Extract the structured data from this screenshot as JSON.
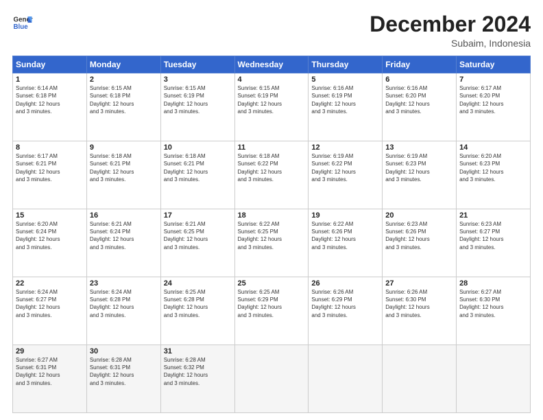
{
  "header": {
    "logo_line1": "General",
    "logo_line2": "Blue",
    "month": "December 2024",
    "location": "Subaim, Indonesia"
  },
  "days_of_week": [
    "Sunday",
    "Monday",
    "Tuesday",
    "Wednesday",
    "Thursday",
    "Friday",
    "Saturday"
  ],
  "weeks": [
    [
      {
        "day": 1,
        "sunrise": "6:14 AM",
        "sunset": "6:18 PM",
        "daylight": "12 hours and 3 minutes."
      },
      {
        "day": 2,
        "sunrise": "6:15 AM",
        "sunset": "6:18 PM",
        "daylight": "12 hours and 3 minutes."
      },
      {
        "day": 3,
        "sunrise": "6:15 AM",
        "sunset": "6:19 PM",
        "daylight": "12 hours and 3 minutes."
      },
      {
        "day": 4,
        "sunrise": "6:15 AM",
        "sunset": "6:19 PM",
        "daylight": "12 hours and 3 minutes."
      },
      {
        "day": 5,
        "sunrise": "6:16 AM",
        "sunset": "6:19 PM",
        "daylight": "12 hours and 3 minutes."
      },
      {
        "day": 6,
        "sunrise": "6:16 AM",
        "sunset": "6:20 PM",
        "daylight": "12 hours and 3 minutes."
      },
      {
        "day": 7,
        "sunrise": "6:17 AM",
        "sunset": "6:20 PM",
        "daylight": "12 hours and 3 minutes."
      }
    ],
    [
      {
        "day": 8,
        "sunrise": "6:17 AM",
        "sunset": "6:21 PM",
        "daylight": "12 hours and 3 minutes."
      },
      {
        "day": 9,
        "sunrise": "6:18 AM",
        "sunset": "6:21 PM",
        "daylight": "12 hours and 3 minutes."
      },
      {
        "day": 10,
        "sunrise": "6:18 AM",
        "sunset": "6:21 PM",
        "daylight": "12 hours and 3 minutes."
      },
      {
        "day": 11,
        "sunrise": "6:18 AM",
        "sunset": "6:22 PM",
        "daylight": "12 hours and 3 minutes."
      },
      {
        "day": 12,
        "sunrise": "6:19 AM",
        "sunset": "6:22 PM",
        "daylight": "12 hours and 3 minutes."
      },
      {
        "day": 13,
        "sunrise": "6:19 AM",
        "sunset": "6:23 PM",
        "daylight": "12 hours and 3 minutes."
      },
      {
        "day": 14,
        "sunrise": "6:20 AM",
        "sunset": "6:23 PM",
        "daylight": "12 hours and 3 minutes."
      }
    ],
    [
      {
        "day": 15,
        "sunrise": "6:20 AM",
        "sunset": "6:24 PM",
        "daylight": "12 hours and 3 minutes."
      },
      {
        "day": 16,
        "sunrise": "6:21 AM",
        "sunset": "6:24 PM",
        "daylight": "12 hours and 3 minutes."
      },
      {
        "day": 17,
        "sunrise": "6:21 AM",
        "sunset": "6:25 PM",
        "daylight": "12 hours and 3 minutes."
      },
      {
        "day": 18,
        "sunrise": "6:22 AM",
        "sunset": "6:25 PM",
        "daylight": "12 hours and 3 minutes."
      },
      {
        "day": 19,
        "sunrise": "6:22 AM",
        "sunset": "6:26 PM",
        "daylight": "12 hours and 3 minutes."
      },
      {
        "day": 20,
        "sunrise": "6:23 AM",
        "sunset": "6:26 PM",
        "daylight": "12 hours and 3 minutes."
      },
      {
        "day": 21,
        "sunrise": "6:23 AM",
        "sunset": "6:27 PM",
        "daylight": "12 hours and 3 minutes."
      }
    ],
    [
      {
        "day": 22,
        "sunrise": "6:24 AM",
        "sunset": "6:27 PM",
        "daylight": "12 hours and 3 minutes."
      },
      {
        "day": 23,
        "sunrise": "6:24 AM",
        "sunset": "6:28 PM",
        "daylight": "12 hours and 3 minutes."
      },
      {
        "day": 24,
        "sunrise": "6:25 AM",
        "sunset": "6:28 PM",
        "daylight": "12 hours and 3 minutes."
      },
      {
        "day": 25,
        "sunrise": "6:25 AM",
        "sunset": "6:29 PM",
        "daylight": "12 hours and 3 minutes."
      },
      {
        "day": 26,
        "sunrise": "6:26 AM",
        "sunset": "6:29 PM",
        "daylight": "12 hours and 3 minutes."
      },
      {
        "day": 27,
        "sunrise": "6:26 AM",
        "sunset": "6:30 PM",
        "daylight": "12 hours and 3 minutes."
      },
      {
        "day": 28,
        "sunrise": "6:27 AM",
        "sunset": "6:30 PM",
        "daylight": "12 hours and 3 minutes."
      }
    ],
    [
      {
        "day": 29,
        "sunrise": "6:27 AM",
        "sunset": "6:31 PM",
        "daylight": "12 hours and 3 minutes."
      },
      {
        "day": 30,
        "sunrise": "6:28 AM",
        "sunset": "6:31 PM",
        "daylight": "12 hours and 3 minutes."
      },
      {
        "day": 31,
        "sunrise": "6:28 AM",
        "sunset": "6:32 PM",
        "daylight": "12 hours and 3 minutes."
      },
      null,
      null,
      null,
      null
    ]
  ],
  "labels": {
    "sunrise": "Sunrise:",
    "sunset": "Sunset:",
    "daylight": "Daylight:"
  },
  "colors": {
    "header_bg": "#3366cc",
    "row_alt": "#f5f5f5"
  }
}
